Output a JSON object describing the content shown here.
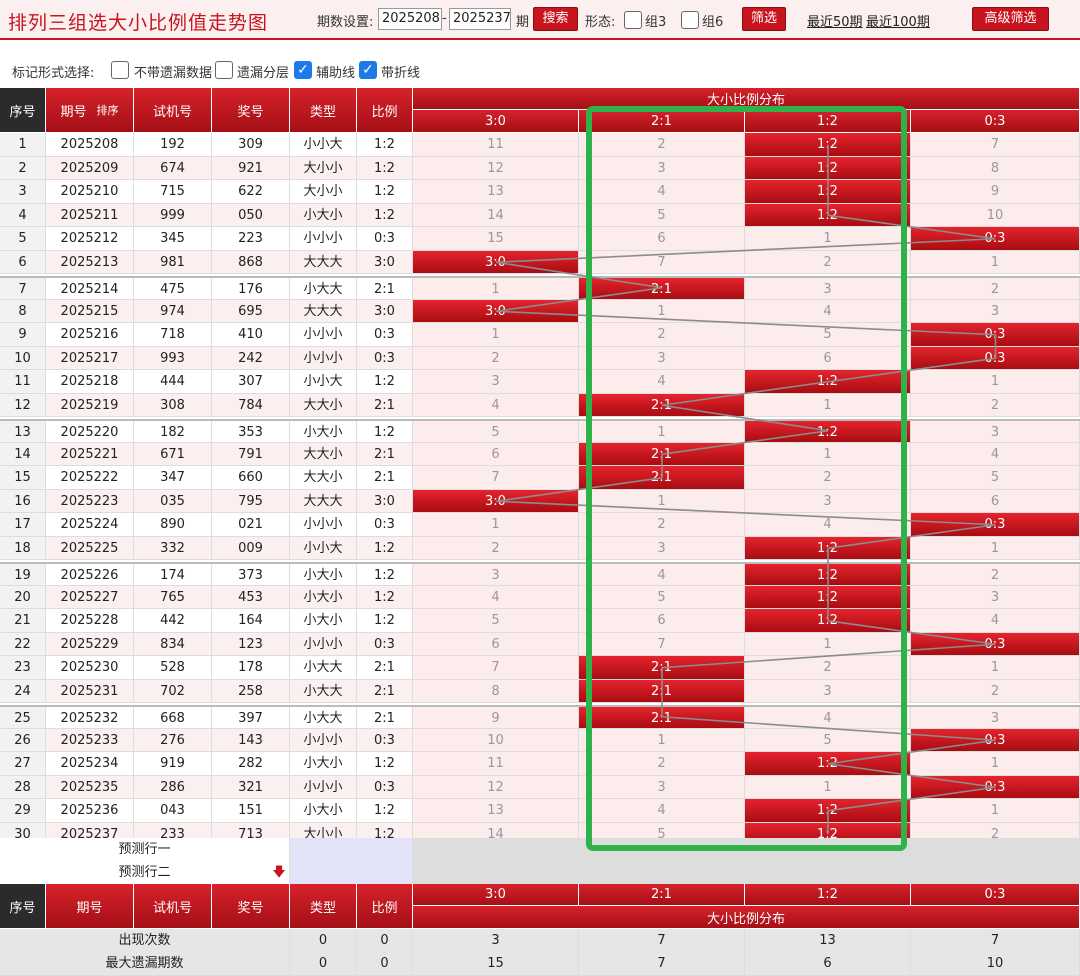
{
  "header": {
    "title": "排列三组选大小比例值走势图",
    "period_label": "期数设置:",
    "start_value": "2025208",
    "dash": "-",
    "end_value": "2025237",
    "period_suffix": "期",
    "search_label": "搜索",
    "form_label": "形态:",
    "group3_label": "组3",
    "group6_label": "组6",
    "filter_label": "筛选",
    "recent50": "最近50期",
    "recent100": "最近100期",
    "advanced": "高级筛选"
  },
  "marks": {
    "label": "标记形式选择:",
    "options": [
      {
        "label": "不带遗漏数据",
        "checked": false
      },
      {
        "label": "遗漏分层",
        "checked": false
      },
      {
        "label": "辅助线",
        "checked": true
      },
      {
        "label": "带折线",
        "checked": true
      }
    ]
  },
  "table": {
    "headers": {
      "seq": "序号",
      "period": "期号",
      "sort": "排序",
      "trial": "试机号",
      "prize": "奖号",
      "type": "类型",
      "ratio": "比例",
      "dist": "大小比例分布"
    },
    "dist_cols": [
      "3:0",
      "2:1",
      "1:2",
      "0:3"
    ],
    "rows": [
      {
        "seq": "1",
        "period": "2025208",
        "trial": "192",
        "prize": "309",
        "type": "小小大",
        "ratio": "1:2",
        "dist": [
          "11",
          "2",
          "1:2",
          "7"
        ],
        "hit": 2
      },
      {
        "seq": "2",
        "period": "2025209",
        "trial": "674",
        "prize": "921",
        "type": "大小小",
        "ratio": "1:2",
        "dist": [
          "12",
          "3",
          "1:2",
          "8"
        ],
        "hit": 2
      },
      {
        "seq": "3",
        "period": "2025210",
        "trial": "715",
        "prize": "622",
        "type": "大小小",
        "ratio": "1:2",
        "dist": [
          "13",
          "4",
          "1:2",
          "9"
        ],
        "hit": 2
      },
      {
        "seq": "4",
        "period": "2025211",
        "trial": "999",
        "prize": "050",
        "type": "小大小",
        "ratio": "1:2",
        "dist": [
          "14",
          "5",
          "1:2",
          "10"
        ],
        "hit": 2
      },
      {
        "seq": "5",
        "period": "2025212",
        "trial": "345",
        "prize": "223",
        "type": "小小小",
        "ratio": "0:3",
        "dist": [
          "15",
          "6",
          "1",
          "0:3"
        ],
        "hit": 3
      },
      {
        "seq": "6",
        "period": "2025213",
        "trial": "981",
        "prize": "868",
        "type": "大大大",
        "ratio": "3:0",
        "dist": [
          "3:0",
          "7",
          "2",
          "1"
        ],
        "hit": 0
      },
      {
        "seq": "7",
        "period": "2025214",
        "trial": "475",
        "prize": "176",
        "type": "小大大",
        "ratio": "2:1",
        "dist": [
          "1",
          "2:1",
          "3",
          "2"
        ],
        "hit": 1
      },
      {
        "seq": "8",
        "period": "2025215",
        "trial": "974",
        "prize": "695",
        "type": "大大大",
        "ratio": "3:0",
        "dist": [
          "3:0",
          "1",
          "4",
          "3"
        ],
        "hit": 0
      },
      {
        "seq": "9",
        "period": "2025216",
        "trial": "718",
        "prize": "410",
        "type": "小小小",
        "ratio": "0:3",
        "dist": [
          "1",
          "2",
          "5",
          "0:3"
        ],
        "hit": 3
      },
      {
        "seq": "10",
        "period": "2025217",
        "trial": "993",
        "prize": "242",
        "type": "小小小",
        "ratio": "0:3",
        "dist": [
          "2",
          "3",
          "6",
          "0:3"
        ],
        "hit": 3
      },
      {
        "seq": "11",
        "period": "2025218",
        "trial": "444",
        "prize": "307",
        "type": "小小大",
        "ratio": "1:2",
        "dist": [
          "3",
          "4",
          "1:2",
          "1"
        ],
        "hit": 2
      },
      {
        "seq": "12",
        "period": "2025219",
        "trial": "308",
        "prize": "784",
        "type": "大大小",
        "ratio": "2:1",
        "dist": [
          "4",
          "2:1",
          "1",
          "2"
        ],
        "hit": 1
      },
      {
        "seq": "13",
        "period": "2025220",
        "trial": "182",
        "prize": "353",
        "type": "小大小",
        "ratio": "1:2",
        "dist": [
          "5",
          "1",
          "1:2",
          "3"
        ],
        "hit": 2
      },
      {
        "seq": "14",
        "period": "2025221",
        "trial": "671",
        "prize": "791",
        "type": "大大小",
        "ratio": "2:1",
        "dist": [
          "6",
          "2:1",
          "1",
          "4"
        ],
        "hit": 1
      },
      {
        "seq": "15",
        "period": "2025222",
        "trial": "347",
        "prize": "660",
        "type": "大大小",
        "ratio": "2:1",
        "dist": [
          "7",
          "2:1",
          "2",
          "5"
        ],
        "hit": 1
      },
      {
        "seq": "16",
        "period": "2025223",
        "trial": "035",
        "prize": "795",
        "type": "大大大",
        "ratio": "3:0",
        "dist": [
          "3:0",
          "1",
          "3",
          "6"
        ],
        "hit": 0
      },
      {
        "seq": "17",
        "period": "2025224",
        "trial": "890",
        "prize": "021",
        "type": "小小小",
        "ratio": "0:3",
        "dist": [
          "1",
          "2",
          "4",
          "0:3"
        ],
        "hit": 3
      },
      {
        "seq": "18",
        "period": "2025225",
        "trial": "332",
        "prize": "009",
        "type": "小小大",
        "ratio": "1:2",
        "dist": [
          "2",
          "3",
          "1:2",
          "1"
        ],
        "hit": 2
      },
      {
        "seq": "19",
        "period": "2025226",
        "trial": "174",
        "prize": "373",
        "type": "小大小",
        "ratio": "1:2",
        "dist": [
          "3",
          "4",
          "1:2",
          "2"
        ],
        "hit": 2
      },
      {
        "seq": "20",
        "period": "2025227",
        "trial": "765",
        "prize": "453",
        "type": "小大小",
        "ratio": "1:2",
        "dist": [
          "4",
          "5",
          "1:2",
          "3"
        ],
        "hit": 2
      },
      {
        "seq": "21",
        "period": "2025228",
        "trial": "442",
        "prize": "164",
        "type": "小大小",
        "ratio": "1:2",
        "dist": [
          "5",
          "6",
          "1:2",
          "4"
        ],
        "hit": 2
      },
      {
        "seq": "22",
        "period": "2025229",
        "trial": "834",
        "prize": "123",
        "type": "小小小",
        "ratio": "0:3",
        "dist": [
          "6",
          "7",
          "1",
          "0:3"
        ],
        "hit": 3
      },
      {
        "seq": "23",
        "period": "2025230",
        "trial": "528",
        "prize": "178",
        "type": "小大大",
        "ratio": "2:1",
        "dist": [
          "7",
          "2:1",
          "2",
          "1"
        ],
        "hit": 1
      },
      {
        "seq": "24",
        "period": "2025231",
        "trial": "702",
        "prize": "258",
        "type": "小大大",
        "ratio": "2:1",
        "dist": [
          "8",
          "2:1",
          "3",
          "2"
        ],
        "hit": 1
      },
      {
        "seq": "25",
        "period": "2025232",
        "trial": "668",
        "prize": "397",
        "type": "小大大",
        "ratio": "2:1",
        "dist": [
          "9",
          "2:1",
          "4",
          "3"
        ],
        "hit": 1
      },
      {
        "seq": "26",
        "period": "2025233",
        "trial": "276",
        "prize": "143",
        "type": "小小小",
        "ratio": "0:3",
        "dist": [
          "10",
          "1",
          "5",
          "0:3"
        ],
        "hit": 3
      },
      {
        "seq": "27",
        "period": "2025234",
        "trial": "919",
        "prize": "282",
        "type": "小大小",
        "ratio": "1:2",
        "dist": [
          "11",
          "2",
          "1:2",
          "1"
        ],
        "hit": 2
      },
      {
        "seq": "28",
        "period": "2025235",
        "trial": "286",
        "prize": "321",
        "type": "小小小",
        "ratio": "0:3",
        "dist": [
          "12",
          "3",
          "1",
          "0:3"
        ],
        "hit": 3
      },
      {
        "seq": "29",
        "period": "2025236",
        "trial": "043",
        "prize": "151",
        "type": "小大小",
        "ratio": "1:2",
        "dist": [
          "13",
          "4",
          "1:2",
          "1"
        ],
        "hit": 2
      },
      {
        "seq": "30",
        "period": "2025237",
        "trial": "233",
        "prize": "713",
        "type": "大小小",
        "ratio": "1:2",
        "dist": [
          "14",
          "5",
          "1:2",
          "2"
        ],
        "hit": 2
      }
    ],
    "predict1": "预测行一",
    "predict2": "预测行二",
    "stats": {
      "label": "出现次数",
      "type": "0",
      "ratio": "0",
      "dist": [
        "3",
        "7",
        "13",
        "7"
      ]
    },
    "stats2": {
      "label": "最大遗漏期数",
      "type": "0",
      "ratio": "0",
      "dist": [
        "15",
        "7",
        "6",
        "10"
      ]
    }
  },
  "colors": {
    "accent": "#c8141e",
    "highlight": "#2db34a"
  }
}
